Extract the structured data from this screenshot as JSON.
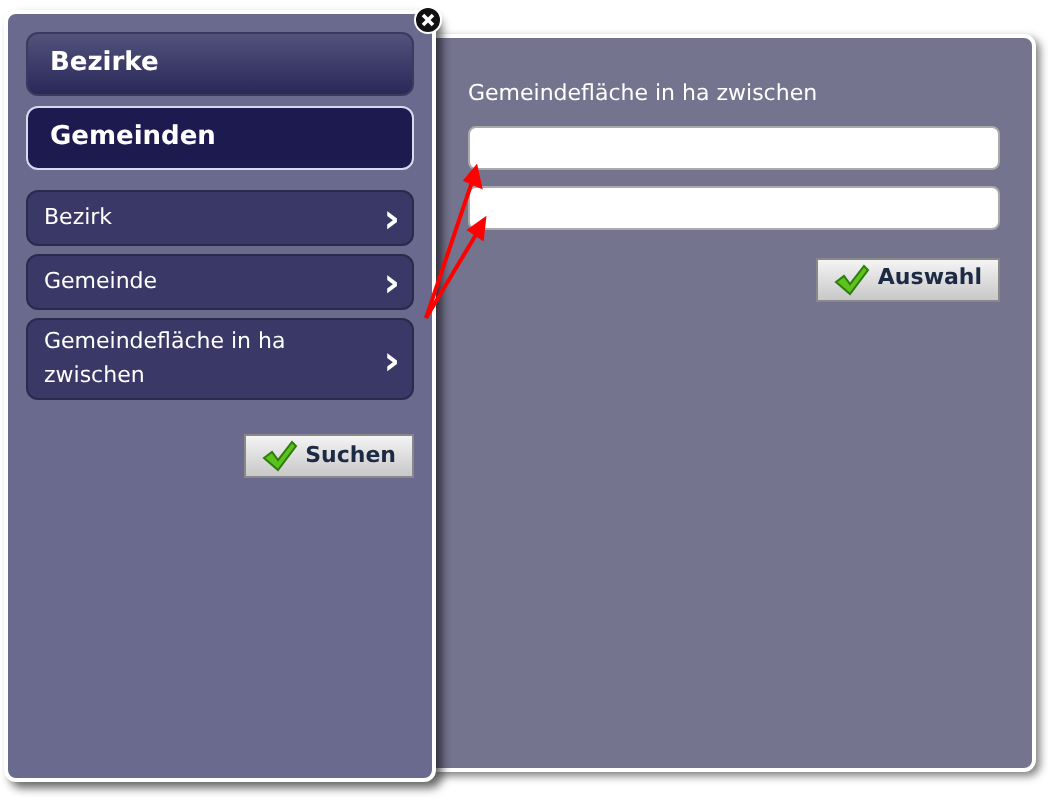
{
  "sections": [
    {
      "label": "Bezirke",
      "selected": false
    },
    {
      "label": "Gemeinden",
      "selected": true
    }
  ],
  "criteria": [
    {
      "label": "Bezirk",
      "arrow": "›"
    },
    {
      "label": "Gemeinde",
      "arrow": "›"
    },
    {
      "label": "Gemeindefläche in ha zwischen",
      "arrow": "›"
    }
  ],
  "search_button": "Suchen",
  "detail": {
    "label": "Gemeindefläche in ha zwischen",
    "fields": [
      {
        "kind": "text"
      },
      {
        "kind": "text"
      }
    ],
    "button": "Auswahl"
  }
}
